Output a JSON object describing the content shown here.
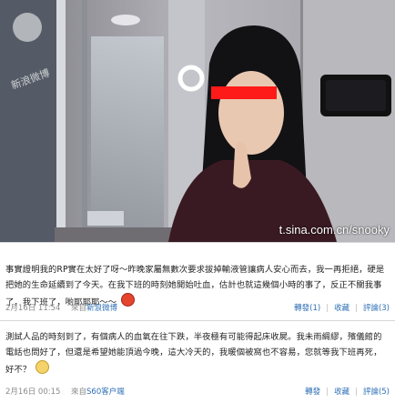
{
  "photo": {
    "watermark": "t.sina.com.cn/snooky"
  },
  "posts": [
    {
      "text": "事實證明我的RP實在太好了呀～昨晚家屬無數次要求拔掉輸液管讓病人安心而去，我一再拒絕，硬是把她的生命延續到了今天。在我下班的時刻她開始吐血，估計也就這幾個小時的事了，反正不關我事了，我下班了，喲耶耶耶～～",
      "emoji": "devil-face-icon",
      "time": "2月16日 11:54",
      "source_prefix": "來自",
      "source": "新浪微博",
      "forward": "轉發(1)",
      "favorite": "收藏",
      "comment": "評論(3)"
    },
    {
      "text": "測試人品的時刻到了，有個病人的血氧在往下跌，半夜極有可能得起床收屍。我未雨綢繆，殯儀館的電話也問好了，但還是希望她能頂過今晚，這大冷天的，我暖個被窩也不容易，您就等我下班再死，好不？",
      "emoji": "smile-face-icon",
      "time": "2月16日 00:15",
      "source_prefix": "來自",
      "source": "S60客户端",
      "forward": "轉發",
      "favorite": "收藏",
      "comment": "評論(5)"
    }
  ]
}
